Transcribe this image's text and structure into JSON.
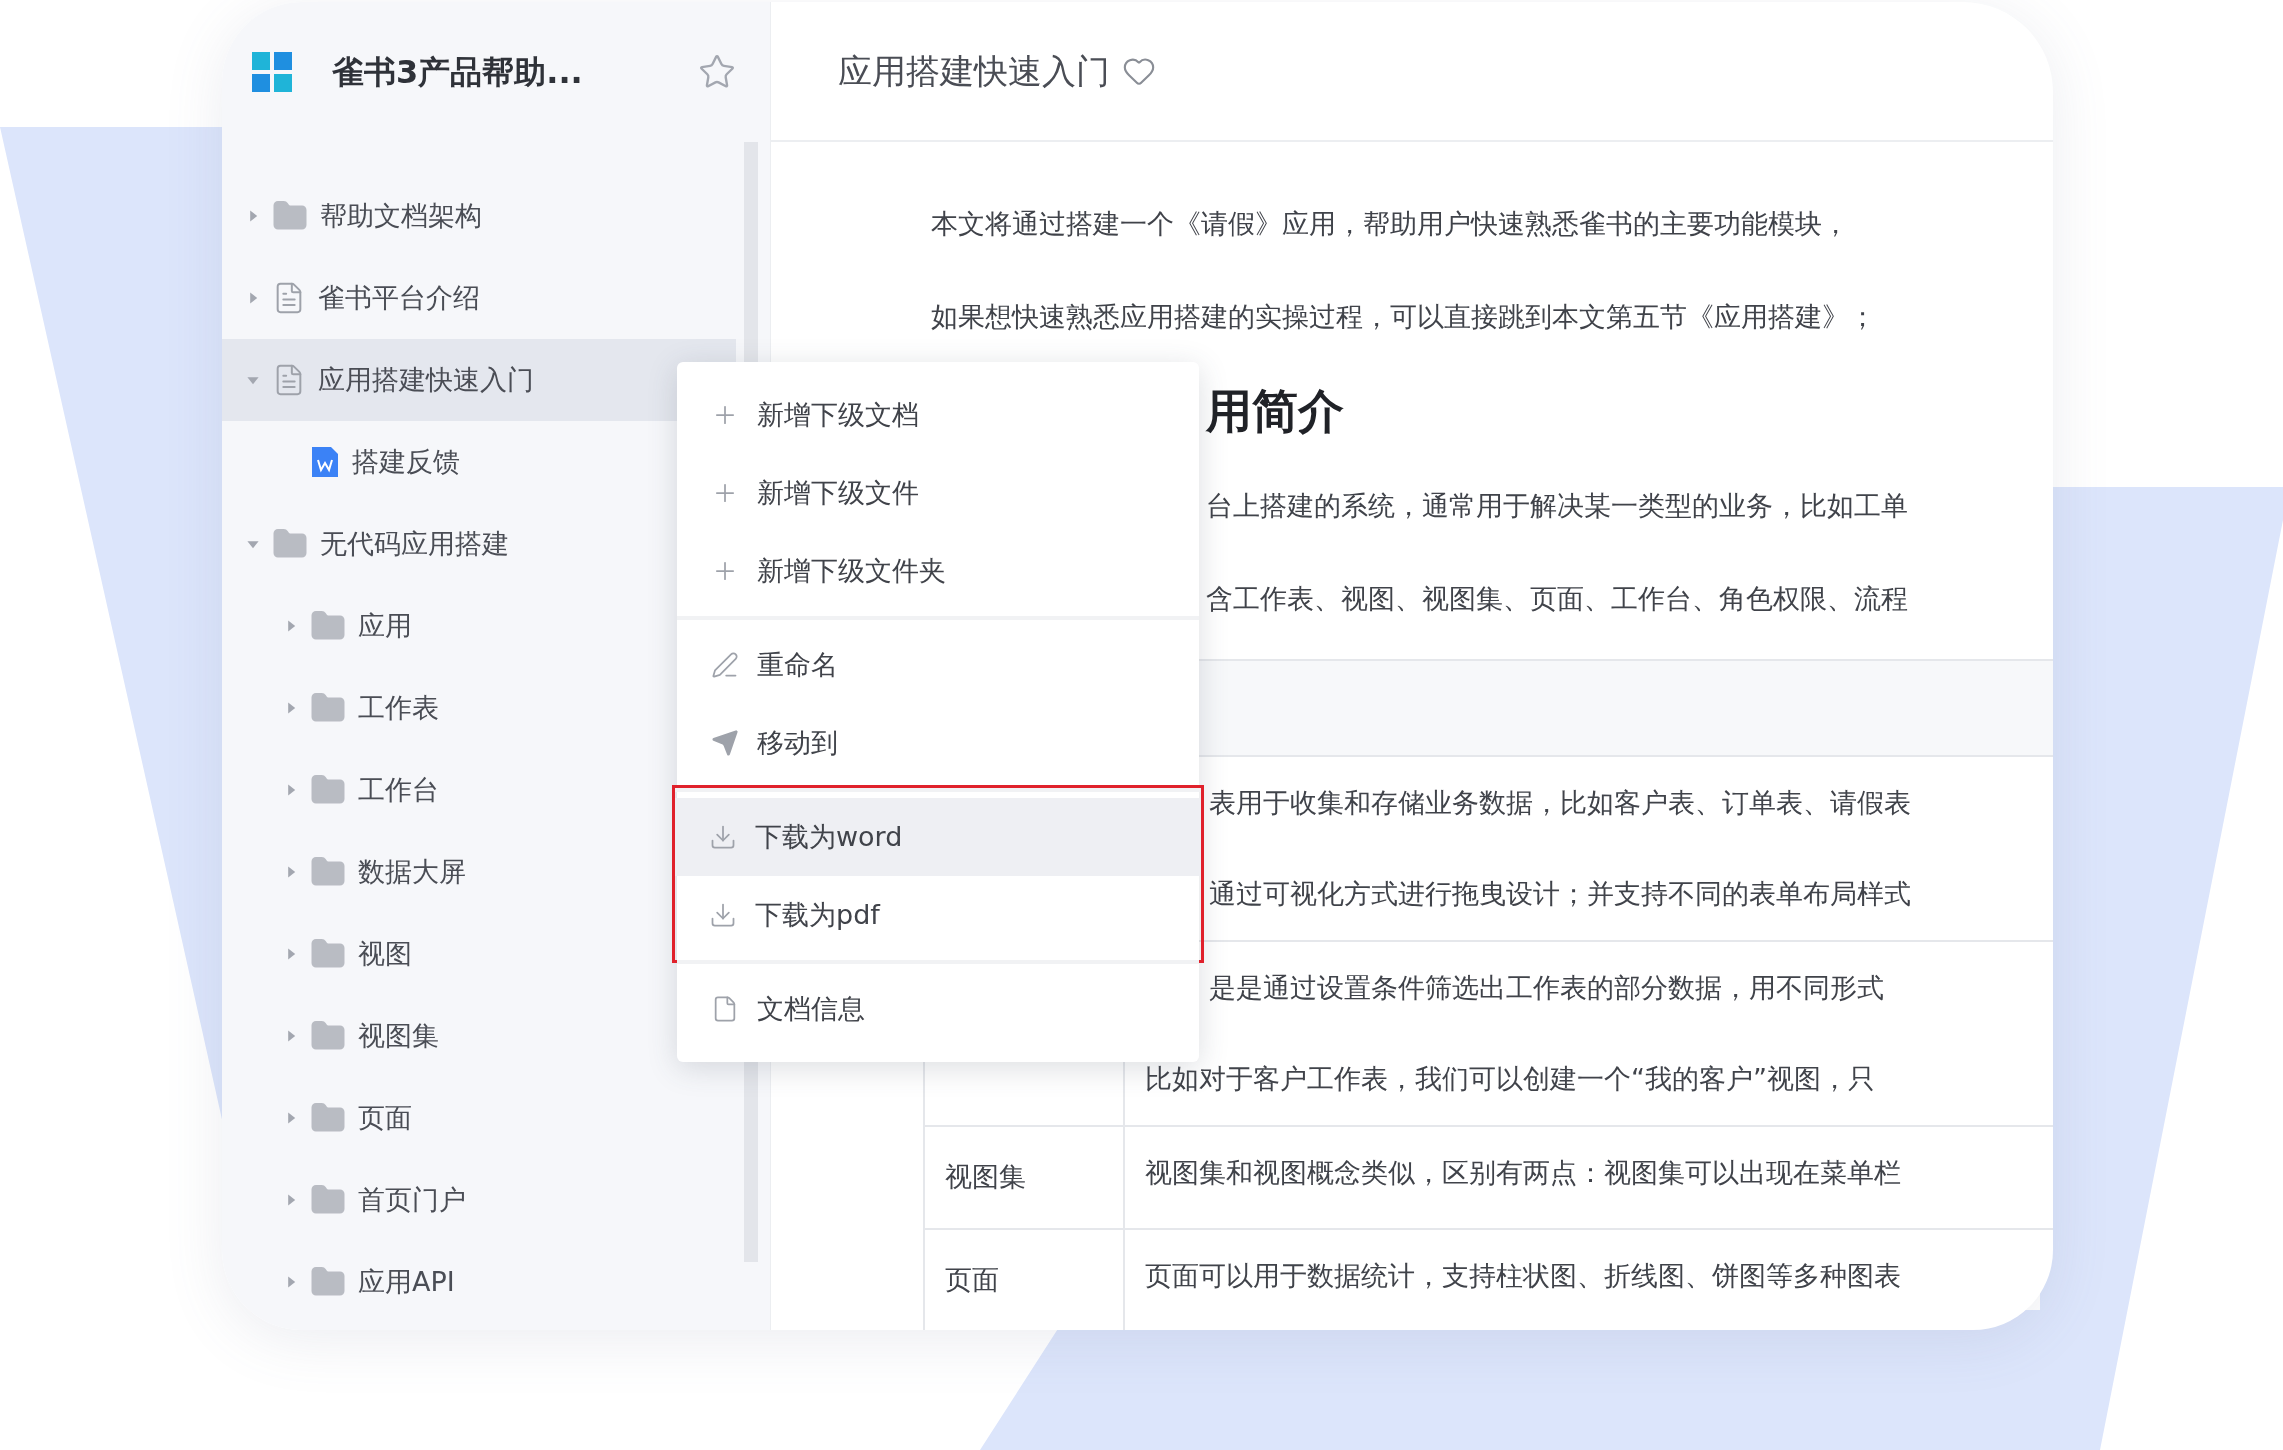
{
  "sidebar": {
    "title": "雀书3产品帮助...",
    "tree": [
      {
        "label": "帮助文档架构",
        "kind": "folder",
        "expanded": false,
        "selected": false
      },
      {
        "label": "雀书平台介绍",
        "kind": "doc",
        "expanded": false,
        "selected": false
      },
      {
        "label": "应用搭建快速入门",
        "kind": "doc",
        "expanded": true,
        "selected": true,
        "children": [
          {
            "label": "搭建反馈",
            "kind": "word",
            "selected": false
          }
        ]
      },
      {
        "label": "无代码应用搭建",
        "kind": "folder",
        "expanded": true,
        "selected": false,
        "children": [
          {
            "label": "应用",
            "kind": "folder",
            "expanded": false,
            "selected": false
          },
          {
            "label": "工作表",
            "kind": "folder",
            "expanded": false,
            "selected": false
          },
          {
            "label": "工作台",
            "kind": "folder",
            "expanded": false,
            "selected": false
          },
          {
            "label": "数据大屏",
            "kind": "folder",
            "expanded": false,
            "selected": false
          },
          {
            "label": "视图",
            "kind": "folder",
            "expanded": false,
            "selected": false
          },
          {
            "label": "视图集",
            "kind": "folder",
            "expanded": false,
            "selected": false
          },
          {
            "label": "页面",
            "kind": "folder",
            "expanded": false,
            "selected": false
          },
          {
            "label": "首页门户",
            "kind": "folder",
            "expanded": false,
            "selected": false
          },
          {
            "label": "应用API",
            "kind": "folder",
            "expanded": false,
            "selected": false
          }
        ]
      }
    ]
  },
  "document": {
    "title": "应用搭建快速入门",
    "intro": [
      "本文将通过搭建一个《请假》应用，帮助用户快速熟悉雀书的主要功能模块，",
      "如果想快速熟悉应用搭建的实操过程，可以直接跳到本文第五节《应用搭建》；"
    ],
    "heading": "用简介",
    "paragraphs": [
      "台上搭建的系统，通常用于解决某一类型的业务，比如工单",
      "含工作表、视图、视图集、页面、工作台、角色权限、流程"
    ],
    "table": {
      "rows": [
        {
          "name": "",
          "lines": [
            {
              "text": "表用于收集和存储业务数据，比如客户表、订单表、请假表",
              "covered": true
            },
            {
              "text": "通过可视化方式进行拖曳设计；并支持不同的表单布局样式",
              "covered": true
            }
          ]
        },
        {
          "name": "",
          "lines": [
            {
              "text": "是是通过设置条件筛选出工作表的部分数据，用不同形式",
              "covered": true
            },
            {
              "text": "比如对于客户工作表，我们可以创建一个“我的客户”视图，只",
              "covered": false
            }
          ]
        },
        {
          "name": "视图集",
          "lines": [
            {
              "text": "视图集和视图概念类似，区别有两点：视图集可以出现在菜单栏",
              "covered": false
            }
          ]
        },
        {
          "name": "页面",
          "lines": [
            {
              "text": "页面可以用于数据统计，支持柱状图、折线图、饼图等多种图表",
              "covered": false
            }
          ]
        }
      ]
    }
  },
  "context_menu": {
    "groups": [
      {
        "outlined": false,
        "items": [
          {
            "label": "新增下级文档",
            "kind": "plus",
            "hovered": false
          },
          {
            "label": "新增下级文件",
            "kind": "plus",
            "hovered": false
          },
          {
            "label": "新增下级文件夹",
            "kind": "plus",
            "hovered": false
          }
        ]
      },
      {
        "outlined": false,
        "items": [
          {
            "label": "重命名",
            "kind": "rename",
            "hovered": false
          },
          {
            "label": "移动到",
            "kind": "move",
            "hovered": false
          }
        ]
      },
      {
        "outlined": true,
        "items": [
          {
            "label": "下载为word",
            "kind": "download",
            "hovered": true
          },
          {
            "label": "下载为pdf",
            "kind": "download",
            "hovered": false
          }
        ]
      },
      {
        "outlined": false,
        "items": [
          {
            "label": "文档信息",
            "kind": "info",
            "hovered": false
          }
        ]
      }
    ]
  }
}
